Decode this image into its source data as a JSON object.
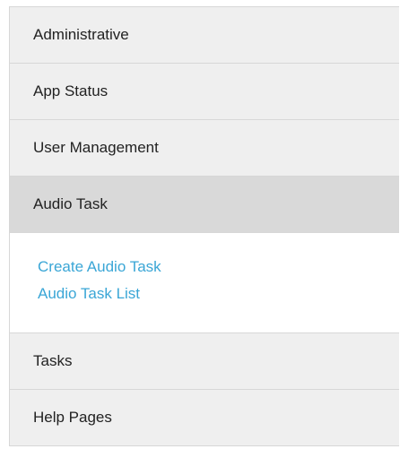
{
  "menu": {
    "items": [
      {
        "label": "Administrative"
      },
      {
        "label": "App Status"
      },
      {
        "label": "User Management"
      },
      {
        "label": "Audio Task"
      },
      {
        "label": "Tasks"
      },
      {
        "label": "Help Pages"
      }
    ],
    "submenu": {
      "links": [
        {
          "label": "Create Audio Task"
        },
        {
          "label": "Audio Task List"
        }
      ]
    }
  },
  "colors": {
    "item_background": "#efefef",
    "active_background": "#d9d9d9",
    "link": "#3aa6d6",
    "border": "#d7d7d7"
  }
}
